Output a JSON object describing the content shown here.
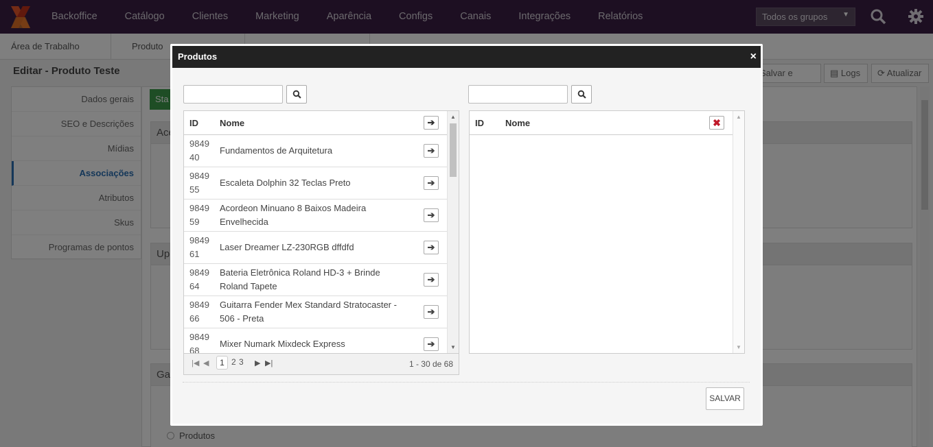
{
  "nav": {
    "items": [
      "Backoffice",
      "Catálogo",
      "Clientes",
      "Marketing",
      "Aparência",
      "Configs",
      "Canais",
      "Integrações",
      "Relatórios"
    ],
    "group_select": "Todos os grupos",
    "brand_color": "#3b1f45"
  },
  "tabs": [
    "Área de Trabalho",
    "Produto"
  ],
  "page": {
    "title": "Editar - Produto Teste",
    "actions": {
      "save_close": "Salvar e fechar",
      "logs": "Logs",
      "refresh": "Atualizar"
    }
  },
  "sidebar": {
    "items": [
      {
        "label": "Dados gerais"
      },
      {
        "label": "SEO e Descrições"
      },
      {
        "label": "Mídias"
      },
      {
        "label": "Associações"
      },
      {
        "label": "Atributos"
      },
      {
        "label": "Skus"
      },
      {
        "label": "Programas de pontos"
      }
    ]
  },
  "background": {
    "section_labels": [
      "Ace",
      "Up",
      "Ga",
      "Sta"
    ],
    "radio_label": "Produtos"
  },
  "modal": {
    "title": "Produtos",
    "close": "×",
    "left": {
      "search_value": "",
      "col_id": "ID",
      "col_name": "Nome",
      "rows": [
        {
          "id": "9849\n40",
          "name": "Fundamentos de Arquitetura"
        },
        {
          "id": "9849\n55",
          "name": "Escaleta Dolphin 32 Teclas Preto"
        },
        {
          "id": "9849\n59",
          "name": "Acordeon Minuano 8 Baixos Madeira Envelhecida"
        },
        {
          "id": "9849\n61",
          "name": "Laser Dreamer LZ-230RGB dffdfd"
        },
        {
          "id": "9849\n64",
          "name": "Bateria Eletrônica Roland HD-3 + Brinde Roland Tapete"
        },
        {
          "id": "9849\n66",
          "name": "Guitarra Fender Mex Standard Stratocaster - 506 - Preta"
        },
        {
          "id": "9849\n68",
          "name": "Mixer Numark Mixdeck Express"
        }
      ],
      "pager": {
        "current": "1",
        "page2": "2",
        "page3": "3",
        "info": "1 - 30 de 68"
      }
    },
    "right": {
      "search_value": "",
      "col_id": "ID",
      "col_name": "Nome"
    },
    "save": "SALVAR"
  }
}
